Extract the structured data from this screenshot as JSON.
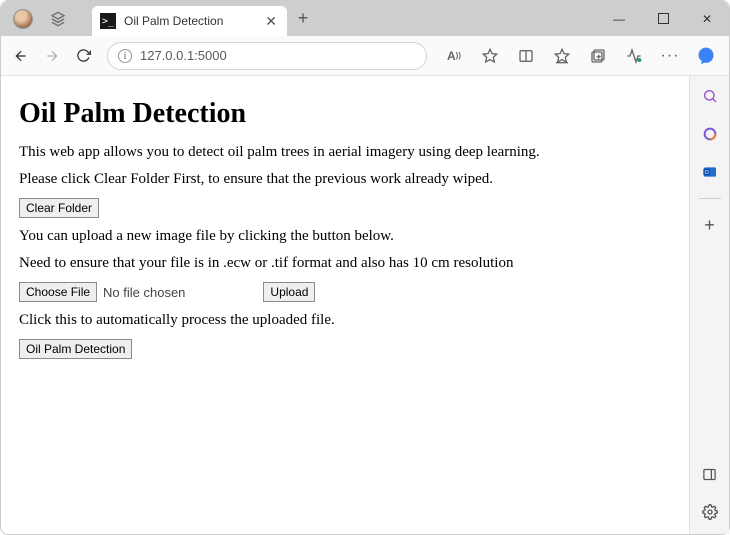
{
  "window": {
    "tab_title": "Oil Palm Detection",
    "new_tab_tooltip": "+",
    "minimize": "—",
    "maximize": "☐",
    "close": "✕"
  },
  "toolbar": {
    "url": "127.0.0.1:5000"
  },
  "page": {
    "heading": "Oil Palm Detection",
    "intro": "This web app allows you to detect oil palm trees in aerial imagery using deep learning.",
    "clear_hint": "Please click Clear Folder First, to ensure that the previous work already wiped.",
    "clear_button": "Clear Folder",
    "upload_hint": "You can upload a new image file by clicking the button below.",
    "format_hint": "Need to ensure that your file is in .ecw or .tif format and also has 10 cm resolution",
    "choose_file_button": "Choose File",
    "no_file_text": "No file chosen",
    "upload_button": "Upload",
    "process_hint": "Click this to automatically process the uploaded file.",
    "detect_button": "Oil Palm Detection"
  }
}
